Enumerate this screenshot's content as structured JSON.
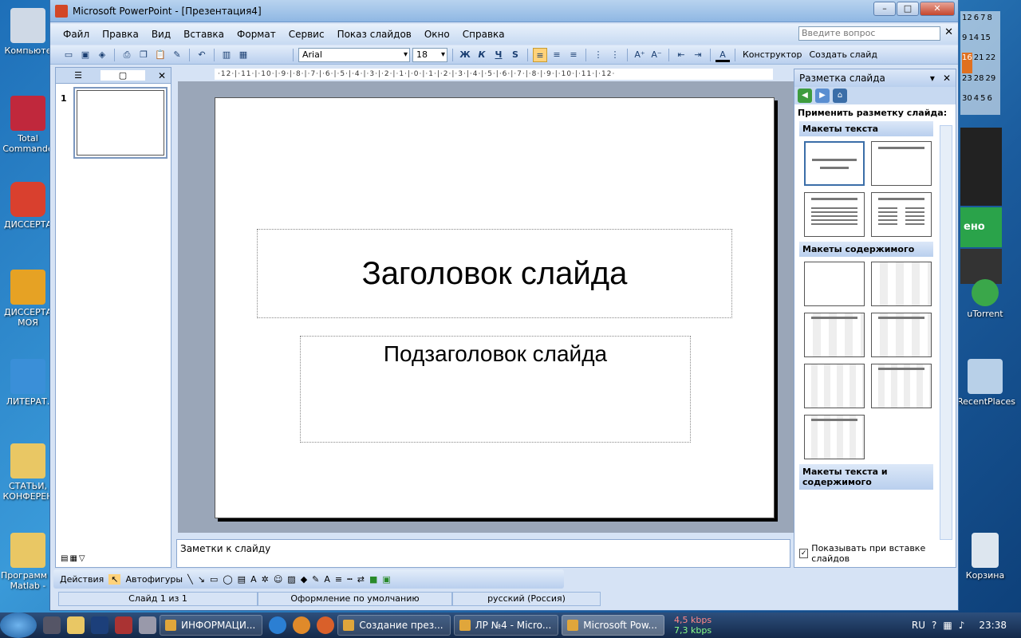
{
  "desktop": {
    "icons_left": [
      "Компьюте",
      "Total Commande",
      "ДИССЕРТА",
      "ДИССЕРТА МОЯ",
      "ЛИТЕРАТ.",
      "СТАТЬИ, КОНФЕРЕН",
      "Программ в Matlab -"
    ],
    "icons_right": [
      "uTorrent",
      "RecentPlaces",
      "Корзина"
    ],
    "widget_text": "ено",
    "calendar": [
      "12",
      "6",
      "7",
      "8",
      "9",
      "14",
      "15",
      "16",
      "21",
      "22",
      "23",
      "28",
      "29",
      "30",
      "4",
      "5",
      "6"
    ]
  },
  "window": {
    "title": "Microsoft PowerPoint - [Презентация4]",
    "min": "–",
    "max": "□",
    "close": "✕"
  },
  "menu": {
    "items": [
      "Файл",
      "Правка",
      "Вид",
      "Вставка",
      "Формат",
      "Сервис",
      "Показ слайдов",
      "Окно",
      "Справка"
    ],
    "ask_placeholder": "Введите вопрос"
  },
  "toolbar": {
    "font": "Arial",
    "size": "18",
    "bold": "Ж",
    "italic": "К",
    "underline": "Ч",
    "shadow": "S",
    "designer": "Конструктор",
    "new_slide": "Создать слайд"
  },
  "ruler": {
    "h": "·12·|·11·|·10·|·9·|·8·|·7·|·6·|·5·|·4·|·3·|·2·|·1·|·0·|·1·|·2·|·3·|·4·|·5·|·6·|·7·|·8·|·9·|·10·|·11·|·12·"
  },
  "slides_pane": {
    "slide_number": "1"
  },
  "slide": {
    "title": "Заголовок слайда",
    "subtitle": "Подзаголовок слайда"
  },
  "notes": {
    "placeholder": "Заметки к слайду"
  },
  "task_pane": {
    "title": "Разметка слайда",
    "apply_label": "Применить разметку слайда:",
    "sections": [
      "Макеты текста",
      "Макеты содержимого",
      "Макеты текста и содержимого"
    ],
    "show_on_insert": "Показывать при вставке слайдов"
  },
  "draw_toolbar": {
    "actions": "Действия",
    "autoshapes": "Автофигуры"
  },
  "status": {
    "slide": "Слайд 1 из 1",
    "design": "Оформление по умолчанию",
    "language": "русский (Россия)"
  },
  "taskbar": {
    "items": [
      "ИНФОРМАЦИ...",
      "Создание през...",
      "ЛР №4 - Micro...",
      "Microsoft Pow..."
    ],
    "down": "4,5 kbps",
    "up": "7,3 kbps",
    "lang": "RU",
    "clock": "23:38"
  }
}
